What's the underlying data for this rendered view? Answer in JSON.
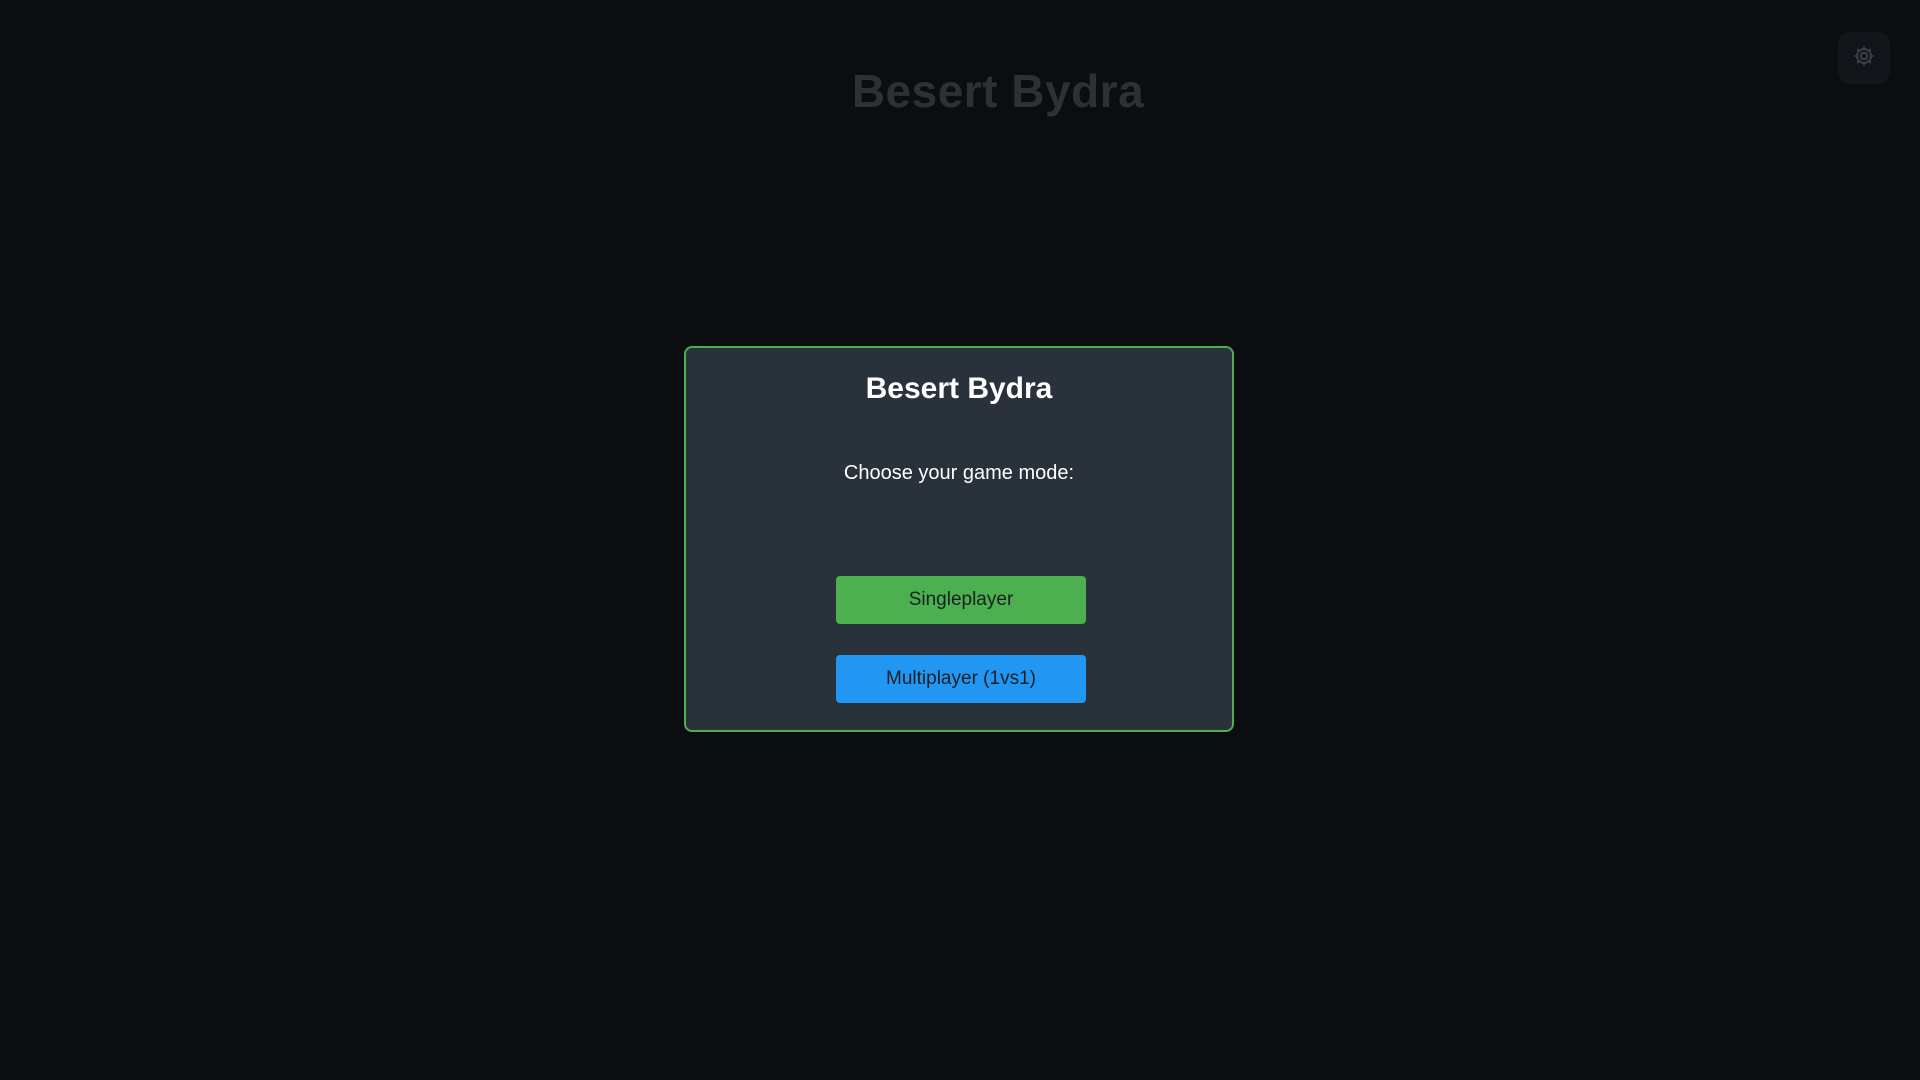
{
  "page": {
    "background_title": "Besert Bydra",
    "settings_icon": "gear-icon"
  },
  "modal": {
    "title": "Besert Bydra",
    "subtitle": "Choose your game mode:",
    "buttons": {
      "singleplayer": "Singleplayer",
      "multiplayer": "Multiplayer (1vs1)"
    }
  },
  "colors": {
    "background": "#0b0d10",
    "modal_background": "#29313a",
    "modal_border": "#4caf50",
    "singleplayer_button": "#4caf50",
    "multiplayer_button": "#2196f3",
    "faded_title": "#2e3133"
  }
}
